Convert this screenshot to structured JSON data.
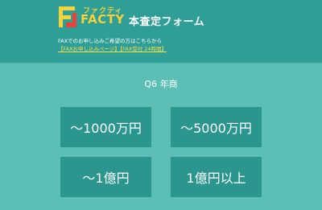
{
  "header": {
    "logo_kana": "ファクティ",
    "logo_word": "FACTY",
    "title": "本査定フォーム",
    "fax_note": "FAXでのお申し込みご希望の方はこちらから",
    "fax_links": "【FAXお申し込みページ】【FAX受付 24時間】"
  },
  "question": {
    "label": "Q6 年商"
  },
  "options": [
    {
      "label": "～1000万円"
    },
    {
      "label": "～5000万円"
    },
    {
      "label": "～1億円"
    },
    {
      "label": "1億円以上"
    }
  ],
  "colors": {
    "background": "#5bbfb5",
    "header": "#2f9e96",
    "button": "#2a968e",
    "logo": "#f3d23b",
    "link": "#f3e14a"
  }
}
